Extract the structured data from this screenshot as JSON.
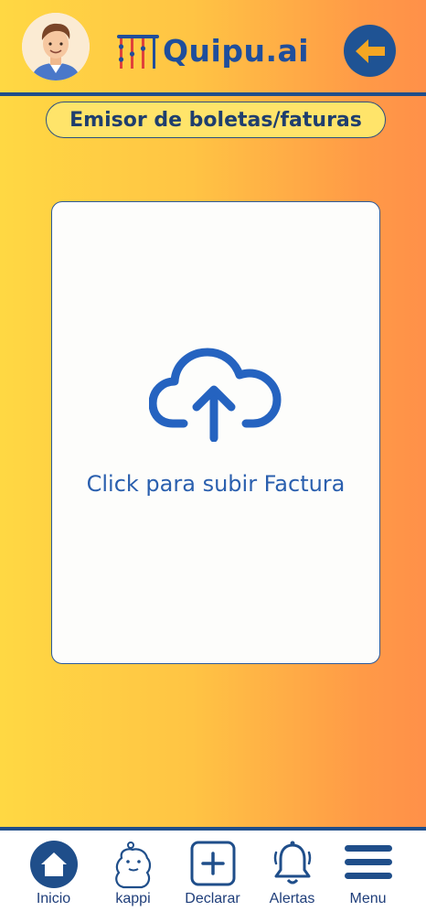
{
  "header": {
    "logo_text": "Quipu.ai",
    "brand_color": "#1F4E9C"
  },
  "page": {
    "title": "Emisor de boletas/faturas"
  },
  "upload": {
    "label": "Click para subir Factura",
    "icon": "cloud-upload-icon",
    "accent_color": "#2A5FAE"
  },
  "nav": {
    "items": [
      {
        "label": "Inicio",
        "icon": "home-icon"
      },
      {
        "label": "kappi",
        "icon": "capybara-icon"
      },
      {
        "label": "Declarar",
        "icon": "plus-square-icon"
      },
      {
        "label": "Alertas",
        "icon": "bell-icon"
      },
      {
        "label": "Menu",
        "icon": "hamburger-icon"
      }
    ]
  }
}
